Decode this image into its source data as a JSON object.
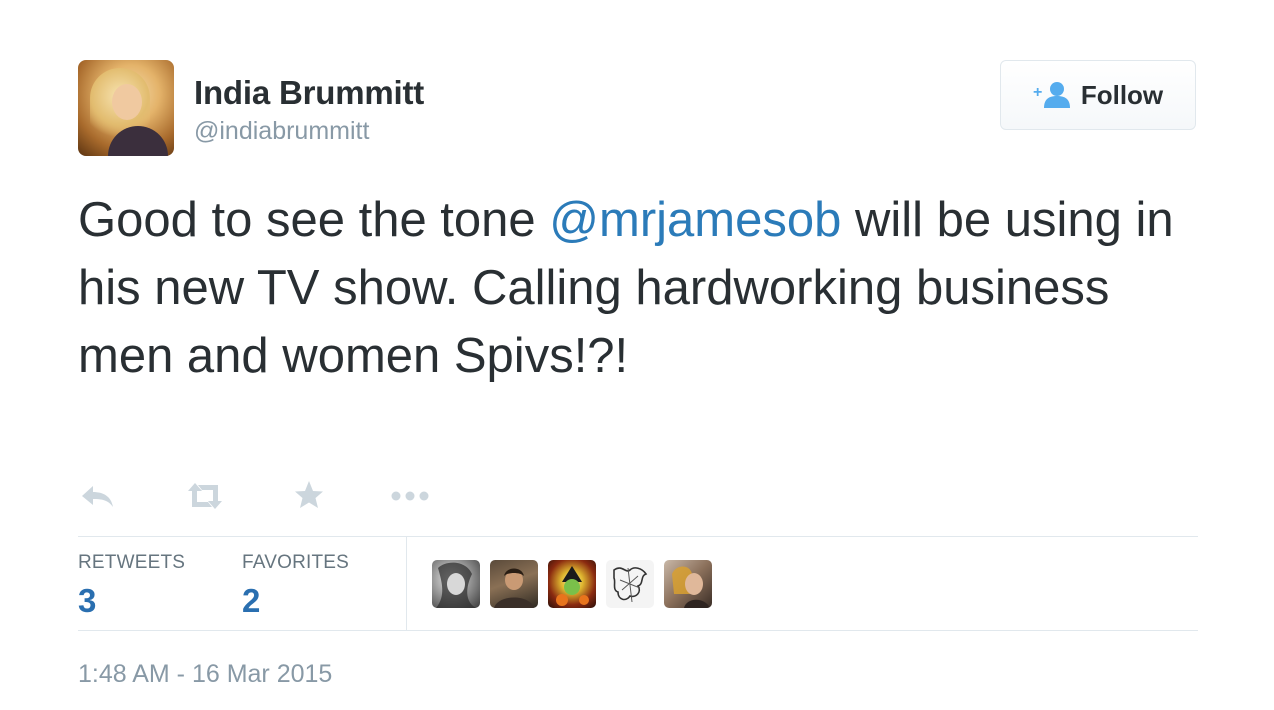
{
  "author": {
    "name": "India Brummitt",
    "handle": "@indiabrummitt"
  },
  "follow_button": {
    "label": "Follow",
    "icon": "follow-user-icon"
  },
  "tweet": {
    "text_before": "Good to see the tone ",
    "mention": "@mrjamesob",
    "text_after": " will be using in his new TV show. Calling hardworking business men and women Spivs!?!"
  },
  "actions": [
    {
      "name": "reply",
      "icon": "reply-icon"
    },
    {
      "name": "retweet",
      "icon": "retweet-icon"
    },
    {
      "name": "favorite",
      "icon": "star-icon"
    },
    {
      "name": "more",
      "icon": "more-icon"
    }
  ],
  "stats": {
    "retweets_label": "RETWEETS",
    "retweets_count": "3",
    "favorites_label": "FAVORITES",
    "favorites_count": "2"
  },
  "favorited_by_count": 5,
  "timestamp": "1:48 AM - 16 Mar 2015",
  "colors": {
    "text": "#292f33",
    "muted": "#8899a6",
    "link": "#2b7bb9",
    "icon": "#ccd6dd",
    "follow_icon": "#55acee",
    "border": "#e1e8ed"
  }
}
